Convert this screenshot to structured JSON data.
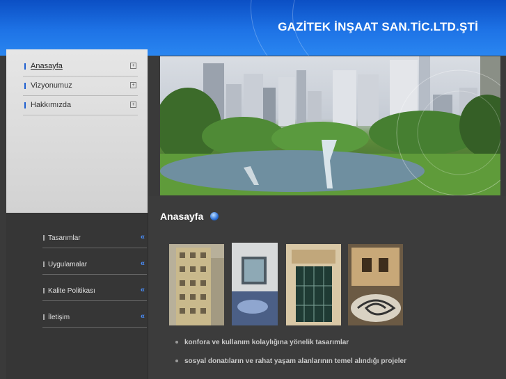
{
  "header": {
    "site_title": "GAZİTEK İNŞAAT SAN.TİC.LTD.ŞTİ"
  },
  "top_nav": {
    "items": [
      {
        "label": "Anasayfa",
        "active": true
      },
      {
        "label": "Vizyonumuz",
        "active": false
      },
      {
        "label": "Hakkımızda",
        "active": false
      }
    ]
  },
  "side_nav": {
    "items": [
      {
        "label": "Tasarımlar"
      },
      {
        "label": "Uygulamalar"
      },
      {
        "label": "Kalite Politikası"
      },
      {
        "label": "İletişim"
      }
    ],
    "chevron": "«"
  },
  "main": {
    "section_title": "Anasayfa",
    "bullets": [
      "konfora ve kullanım kolaylığına yönelik tasarımlar",
      "sosyal donatıların ve rahat yaşam alanlarının temel alındığı projeler"
    ]
  },
  "icons": {
    "plus": "plus-box-icon",
    "chevron": "double-chevron-left-icon",
    "title_dot": "blue-orb-icon"
  },
  "colors": {
    "header_blue": "#1e73e6",
    "accent_blue": "#4a90ff",
    "background": "#3a3a3a"
  }
}
